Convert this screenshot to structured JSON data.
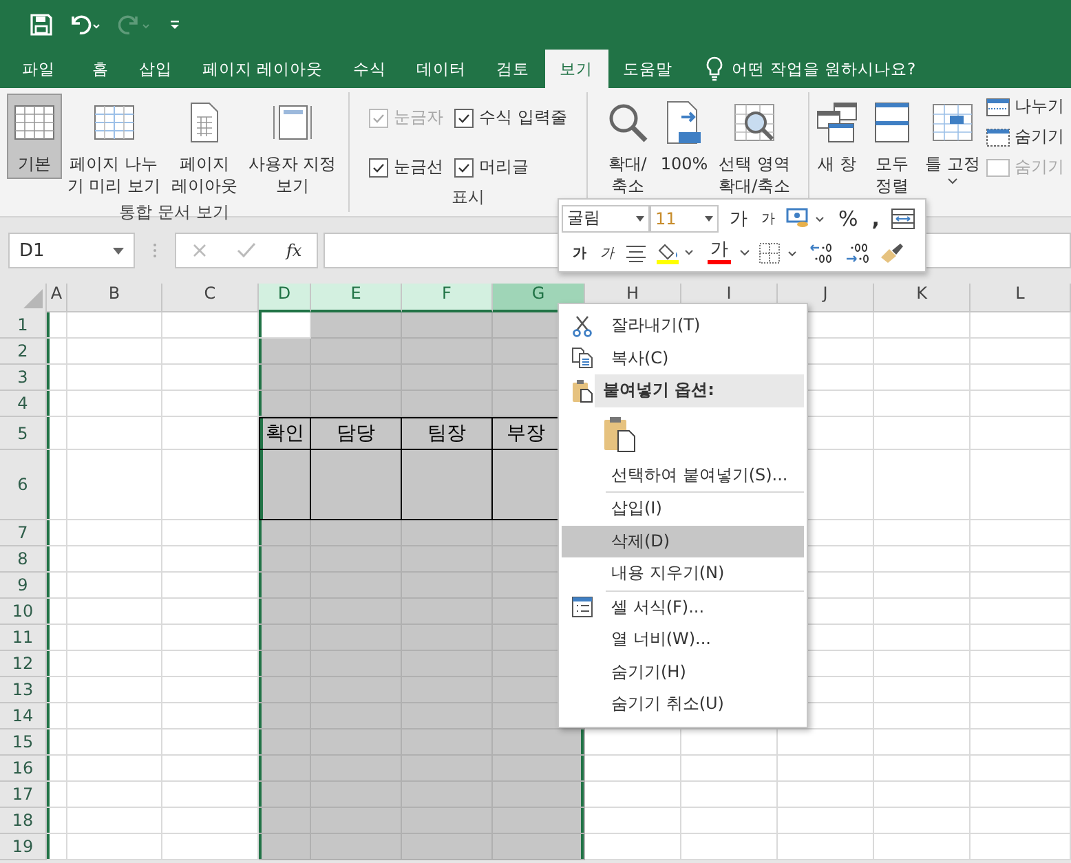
{
  "tabs": [
    {
      "label": "파일",
      "selected": false
    },
    {
      "label": "홈",
      "selected": false
    },
    {
      "label": "삽입",
      "selected": false
    },
    {
      "label": "페이지 레이아웃",
      "selected": false
    },
    {
      "label": "수식",
      "selected": false
    },
    {
      "label": "데이터",
      "selected": false
    },
    {
      "label": "검토",
      "selected": false
    },
    {
      "label": "보기",
      "selected": true
    },
    {
      "label": "도움말",
      "selected": false
    }
  ],
  "tell_me": "어떤 작업을 원하시나요?",
  "view_group": {
    "label": "통합 문서 보기",
    "buttons": [
      {
        "kind": "normal",
        "lines": [
          "기본"
        ],
        "selected": true
      },
      {
        "kind": "page-break",
        "lines": [
          "페이지 나누",
          "기 미리 보기"
        ],
        "selected": false
      },
      {
        "kind": "page-layout",
        "lines": [
          "페이지",
          "레이아웃"
        ],
        "selected": false
      },
      {
        "kind": "custom",
        "lines": [
          "사용자 지정",
          "보기"
        ],
        "selected": false
      }
    ]
  },
  "show_group": {
    "label": "표시",
    "options": [
      {
        "label": "눈금자",
        "checked": true,
        "disabled": true
      },
      {
        "label": "수식 입력줄",
        "checked": true,
        "disabled": false
      },
      {
        "label": "눈금선",
        "checked": true,
        "disabled": false
      },
      {
        "label": "머리글",
        "checked": true,
        "disabled": false
      }
    ]
  },
  "zoom_group": {
    "buttons": [
      {
        "kind": "zoom",
        "lines": [
          "확대/",
          "축소"
        ]
      },
      {
        "kind": "zoom-100",
        "lines": [
          "100%"
        ]
      },
      {
        "kind": "zoom-selection",
        "lines": [
          "선택 영역",
          "확대/축소"
        ]
      }
    ]
  },
  "window_group": {
    "buttons": [
      {
        "kind": "new-window",
        "lines": [
          "새 창"
        ]
      },
      {
        "kind": "arrange",
        "lines": [
          "모두",
          "정렬"
        ]
      },
      {
        "kind": "freeze",
        "lines": [
          "틀 고정"
        ]
      }
    ],
    "small": [
      {
        "kind": "split",
        "label": "나누기",
        "disabled": false
      },
      {
        "kind": "hide",
        "label": "숨기기",
        "disabled": false
      },
      {
        "kind": "unhide",
        "label": "숨기기",
        "disabled": true
      }
    ]
  },
  "formula_bar": {
    "name_box": "D1",
    "function_label": "fx"
  },
  "sheet": {
    "columns": [
      {
        "label": "A",
        "selected": false,
        "hovered": false
      },
      {
        "label": "B",
        "selected": false,
        "hovered": false
      },
      {
        "label": "C",
        "selected": false,
        "hovered": false
      },
      {
        "label": "D",
        "selected": true,
        "hovered": false
      },
      {
        "label": "E",
        "selected": true,
        "hovered": false
      },
      {
        "label": "F",
        "selected": true,
        "hovered": false
      },
      {
        "label": "G",
        "selected": true,
        "hovered": true
      },
      {
        "label": "H",
        "selected": false,
        "hovered": false
      },
      {
        "label": "I",
        "selected": false,
        "hovered": false
      },
      {
        "label": "J",
        "selected": false,
        "hovered": false
      },
      {
        "label": "K",
        "selected": false,
        "hovered": false
      },
      {
        "label": "L",
        "selected": false,
        "hovered": false
      }
    ],
    "rows": [
      "1",
      "2",
      "3",
      "4",
      "5",
      "6",
      "7",
      "8",
      "9",
      "10",
      "11",
      "12",
      "13",
      "14",
      "15",
      "16",
      "17",
      "18",
      "19"
    ],
    "table_headers": [
      "확인",
      "담당",
      "팀장",
      "부장"
    ]
  },
  "mini_toolbar": {
    "font": "굴림",
    "size": "11",
    "grow": "가",
    "shrink": "가",
    "percent": "%",
    "comma": ",",
    "bold": "가",
    "italic": "가",
    "font_color": "가"
  },
  "context_menu": [
    {
      "kind": "cut",
      "label": "잘라내기(T)",
      "highlighted": false
    },
    {
      "kind": "copy",
      "label": "복사(C)",
      "highlighted": false
    },
    {
      "kind": "header",
      "label": "붙여넣기 옵션:"
    },
    {
      "kind": "paste-options"
    },
    {
      "kind": "item",
      "label": "선택하여 붙여넣기(S)...",
      "highlighted": false
    },
    {
      "kind": "separator"
    },
    {
      "kind": "item",
      "label": "삽입(I)",
      "highlighted": false
    },
    {
      "kind": "item",
      "label": "삭제(D)",
      "highlighted": true
    },
    {
      "kind": "item",
      "label": "내용 지우기(N)",
      "highlighted": false
    },
    {
      "kind": "separator"
    },
    {
      "kind": "format-cells",
      "label": "셀 서식(F)...",
      "highlighted": false
    },
    {
      "kind": "item",
      "label": "열 너비(W)...",
      "highlighted": false
    },
    {
      "kind": "item",
      "label": "숨기기(H)",
      "highlighted": false
    },
    {
      "kind": "item",
      "label": "숨기기 취소(U)",
      "highlighted": false
    }
  ]
}
